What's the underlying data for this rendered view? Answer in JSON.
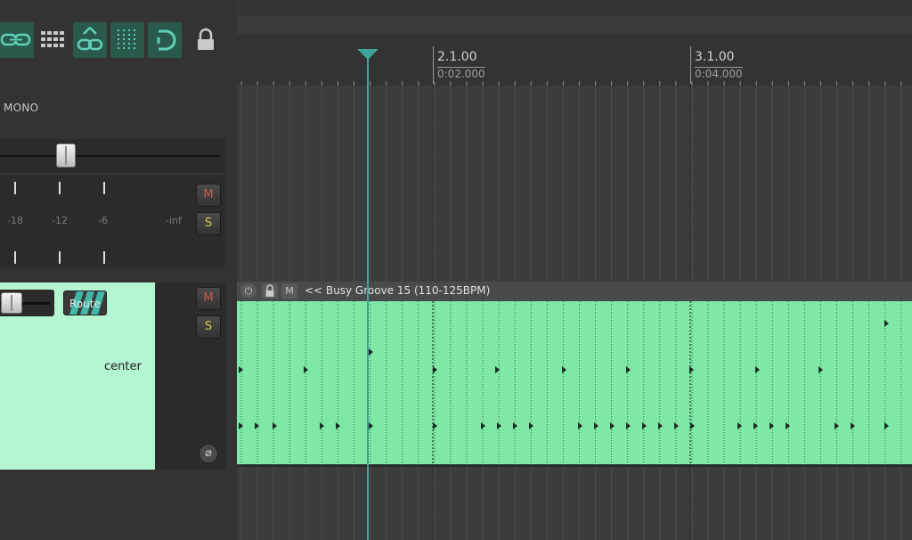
{
  "toolbar": {
    "buttons": [
      {
        "name": "link-icon",
        "active": true
      },
      {
        "name": "grid-icon",
        "active": false
      },
      {
        "name": "group-link-icon",
        "active": true
      },
      {
        "name": "dotted-grid-icon",
        "active": true
      },
      {
        "name": "loop-icon",
        "active": true
      },
      {
        "name": "lock-icon",
        "active": false
      }
    ]
  },
  "track1": {
    "mono_label": "MONO",
    "meter_labels": [
      "-18",
      "-12",
      "-6",
      "-inf"
    ],
    "mute_label": "M",
    "solo_label": "S"
  },
  "track2": {
    "route_label": "Route",
    "pan_label": "center",
    "mute_label": "M",
    "solo_label": "S",
    "phase_icon": "⌀"
  },
  "ruler": {
    "markers": [
      {
        "bar": "2.1.00",
        "time": "0:02.000"
      },
      {
        "bar": "3.1.00",
        "time": "0:04.000"
      }
    ]
  },
  "item": {
    "title": "<< Busy Groove 15 (110-125BPM)",
    "header_icons": [
      "power-icon",
      "lock-icon",
      "mute-icon"
    ],
    "mute_icon_label": "M",
    "color": "#7ee9a6"
  },
  "colors": {
    "accent": "#3fa59a",
    "track_selected": "#b4f5d2",
    "mute": "#c85a4e",
    "solo": "#d6c94f"
  }
}
